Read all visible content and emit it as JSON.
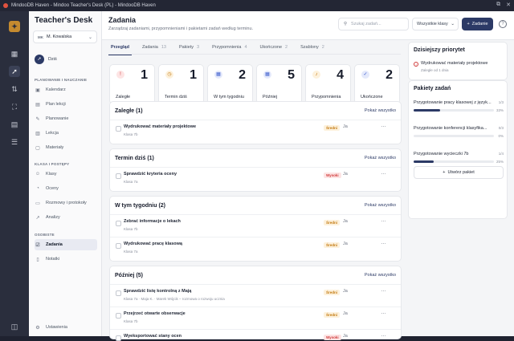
{
  "window": {
    "title": "MindooDB Haven - Mindoo Teacher's Desk (PL) - MindooDB Haven"
  },
  "rail": {
    "items": [
      "dashboard-icon",
      "rocket-icon",
      "transfer-icon",
      "scan-icon",
      "database-icon",
      "sliders-icon"
    ],
    "bottom": "panel-toggle-icon"
  },
  "sidebar": {
    "brand": "Teacher's Desk",
    "user": {
      "initials": "MK",
      "name": "M. Kowalska"
    },
    "today": "Dziś",
    "sections": [
      {
        "title": "PLANOWANIE I NAUCZANIE",
        "items": [
          "Kalendarz",
          "Plan lekcji",
          "Planowanie",
          "Lekcja",
          "Materiały"
        ]
      },
      {
        "title": "KLASA I POSTĘPY",
        "items": [
          "Klasy",
          "Oceny",
          "Rozmowy i protokoły",
          "Analizy"
        ]
      },
      {
        "title": "OSOBISTE",
        "items": [
          "Zadania",
          "Notatki"
        ]
      }
    ],
    "settings": "Ustawienia"
  },
  "header": {
    "title": "Zadania",
    "subtitle": "Zarządzaj zadaniami, przypomnieniami i pakietami zadań według terminu.",
    "search_placeholder": "Szukaj zadań...",
    "filter": "Wszystkie klasy",
    "add_button": "Zadanie",
    "help": "?"
  },
  "tabs": [
    {
      "label": "Przegląd",
      "count": ""
    },
    {
      "label": "Zadania",
      "count": "13"
    },
    {
      "label": "Pakiety",
      "count": "3"
    },
    {
      "label": "Przypomnienia",
      "count": "4"
    },
    {
      "label": "Ukończone",
      "count": "2"
    },
    {
      "label": "Szablony",
      "count": "2"
    }
  ],
  "stats": [
    {
      "label": "Zaległe",
      "value": "1",
      "icon": "alert-icon",
      "color": "#d03b3b",
      "bg": "#fde4e4"
    },
    {
      "label": "Termin dziś",
      "value": "1",
      "icon": "clock-icon",
      "color": "#c2780d",
      "bg": "#fdf1dc"
    },
    {
      "label": "W tym tygodniu",
      "value": "2",
      "icon": "calendar-icon",
      "color": "#3b5bcc",
      "bg": "#e4e9fb"
    },
    {
      "label": "Później",
      "value": "5",
      "icon": "calendar-icon",
      "color": "#3b5bcc",
      "bg": "#e4e9fb"
    },
    {
      "label": "Przypomnienia",
      "value": "4",
      "icon": "bell-icon",
      "color": "#c2780d",
      "bg": "#fdf1dc"
    },
    {
      "label": "Ukończone",
      "value": "2",
      "icon": "check-icon",
      "color": "#3b5bcc",
      "bg": "#e4e9fb"
    }
  ],
  "groups": [
    {
      "title": "Zaległe (1)",
      "link": "Pokaż wszystko",
      "tasks": [
        {
          "title": "Wydrukować materiały projektowe",
          "sub": "Klasa 7b",
          "priority": "Średni",
          "level": "med",
          "assignee": "Ja"
        }
      ]
    },
    {
      "title": "Termin dziś (1)",
      "link": "Pokaż wszystko",
      "tasks": [
        {
          "title": "Sprawdzić kryteria oceny",
          "sub": "Klasa 7a",
          "priority": "Wysoki",
          "level": "high",
          "assignee": "Ja"
        }
      ]
    },
    {
      "title": "W tym tygodniu (2)",
      "link": "Pokaż wszystko",
      "tasks": [
        {
          "title": "Zebrać informacje o lekach",
          "sub": "Klasa 7b",
          "priority": "Średni",
          "level": "med",
          "assignee": "Ja"
        },
        {
          "title": "Wydrukować pracę klasową",
          "sub": "Klasa 7a",
          "priority": "Średni",
          "level": "med",
          "assignee": "Ja"
        }
      ]
    },
    {
      "title": "Później (5)",
      "link": "Pokaż wszystko",
      "tasks": [
        {
          "title": "Sprawdzić listę kontrolną z Mają",
          "sub": "Klasa 7a · Maja K. · Marek Wójcik – rozmowa o rozwoju ucznia",
          "priority": "Średni",
          "level": "med",
          "assignee": "Ja"
        },
        {
          "title": "Przejrzeć otwarte obserwacje",
          "sub": "Klasa 7b",
          "priority": "Średni",
          "level": "med",
          "assignee": "Ja"
        },
        {
          "title": "Wyeksportować stany ocen",
          "sub": "",
          "priority": "Wysoki",
          "level": "high",
          "assignee": "Ja"
        }
      ]
    }
  ],
  "priority_panel": {
    "title": "Dzisiejszy priorytet",
    "task": "Wydrukować materiały projektowe",
    "sub": "Zaległe od 1 dnia"
  },
  "bundles_panel": {
    "title": "Pakiety zadań",
    "items": [
      {
        "name": "Przygotowanie pracy klasowej z język...",
        "count": "1/3",
        "progress": 0.33,
        "percent": "33%"
      },
      {
        "name": "Przygotowanie konferencji klasyfika...",
        "count": "0/3",
        "progress": 0,
        "percent": "0%"
      },
      {
        "name": "Przygotowanie wycieczki 7b",
        "count": "1/4",
        "progress": 0.25,
        "percent": "25%"
      }
    ],
    "create": "Utwórz pakiet"
  }
}
